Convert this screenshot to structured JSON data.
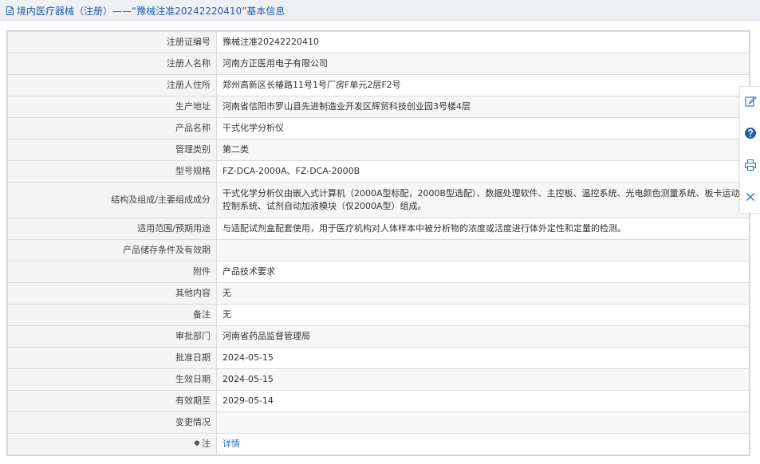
{
  "header": {
    "title": "境内医疗器械（注册）——“豫械注准20242220410”基本信息"
  },
  "colors": {
    "title_text": "#1f5fa8",
    "link": "#2a6ab8",
    "label_bg": "#f4f4f5",
    "border": "#d8dbe0"
  },
  "rows": [
    {
      "label": "注册证编号",
      "value": "豫械注准20242220410"
    },
    {
      "label": "注册人名称",
      "value": "河南方正医用电子有限公司"
    },
    {
      "label": "注册人住所",
      "value": "郑州高新区长椿路11号1号厂房F单元2层F2号"
    },
    {
      "label": "生产地址",
      "value": "河南省信阳市罗山县先进制造业开发区辉贸科技创业园3号楼4层"
    },
    {
      "label": "产品名称",
      "value": "干式化学分析仪"
    },
    {
      "label": "管理类别",
      "value": "第二类"
    },
    {
      "label": "型号规格",
      "value": "FZ-DCA-2000A、FZ-DCA-2000B"
    },
    {
      "label": "结构及组成/主要组成成分",
      "value": "干式化学分析仪由嵌入式计算机（2000A型标配，2000B型选配）、数据处理软件、主控板、温控系统、光电颜色测量系统、板卡运动控制系统、试剂自动加液模块（仅2000A型）组成。"
    },
    {
      "label": "适用范围/预期用途",
      "value": "与适配试剂盒配套使用，用于医疗机构对人体样本中被分析物的浓度或活度进行体外定性和定量的检测。"
    },
    {
      "label": "产品储存条件及有效期",
      "value": ""
    },
    {
      "label": "附件",
      "value": "产品技术要求"
    },
    {
      "label": "其他内容",
      "value": "无"
    },
    {
      "label": "备注",
      "value": "无"
    },
    {
      "label": "审批部门",
      "value": "河南省药品监督管理局"
    },
    {
      "label": "批准日期",
      "value": "2024-05-15"
    },
    {
      "label": "生效日期",
      "value": "2024-05-15"
    },
    {
      "label": "有效期至",
      "value": "2029-05-14"
    },
    {
      "label": "变更情况",
      "value": ""
    }
  ],
  "note_row": {
    "label": "注",
    "link_text": "详情"
  },
  "side_tools": [
    {
      "icon": "edit-icon"
    },
    {
      "icon": "help-icon"
    },
    {
      "icon": "print-icon"
    },
    {
      "icon": "close-icon"
    }
  ]
}
